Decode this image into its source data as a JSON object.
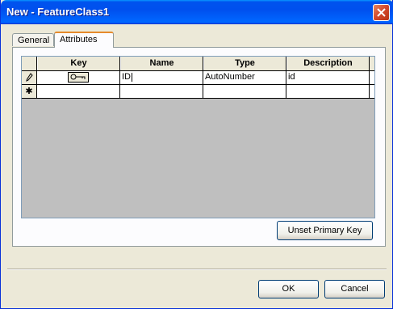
{
  "window": {
    "title": "New - FeatureClass1"
  },
  "tabs": [
    {
      "label": "General",
      "selected": false
    },
    {
      "label": "Attributes",
      "selected": true
    }
  ],
  "grid": {
    "columns": [
      "Key",
      "Name",
      "Type",
      "Description"
    ],
    "rows": [
      {
        "selector": "✎",
        "is_key": true,
        "name": "ID",
        "type": "AutoNumber",
        "description": "id"
      }
    ],
    "new_row_selector": "✱"
  },
  "buttons": {
    "unset_primary_key": "Unset Primary Key",
    "ok": "OK",
    "cancel": "Cancel"
  },
  "icons": {
    "close": "close-icon",
    "edit": "pencil-icon",
    "key": "key-icon",
    "new_row": "asterisk-icon"
  },
  "colors": {
    "title_bar": "#0053EE",
    "close_button": "#D2472A",
    "tab_highlight": "#E68B2C",
    "grid_background": "#BFBFBF"
  }
}
